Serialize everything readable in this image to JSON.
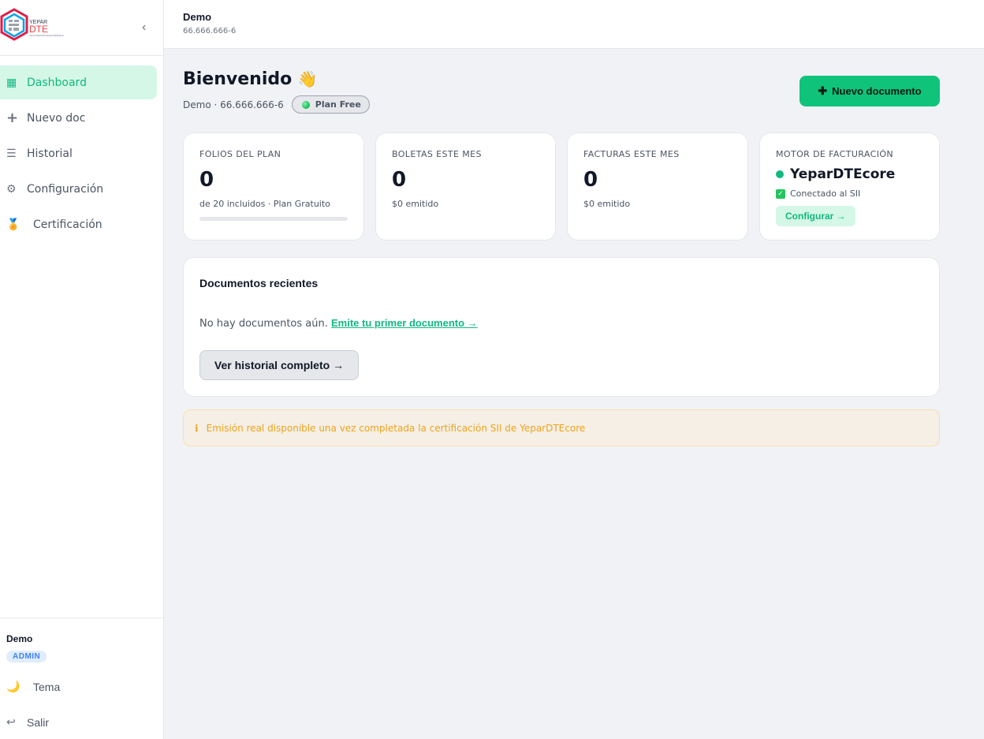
{
  "brand": {
    "logo_top": "YEPAR",
    "logo_main": "DTE",
    "logo_tagline": "FACTURACIÓN ELECTRÓNICA",
    "collapse": "‹"
  },
  "sidebar": {
    "items": [
      {
        "label": "Dashboard",
        "icon": "grid-icon",
        "glyph": "▦",
        "active": true
      },
      {
        "label": "Nuevo doc",
        "icon": "plus-icon",
        "glyph": "+"
      },
      {
        "label": "Historial",
        "icon": "list-icon",
        "glyph": "☰"
      },
      {
        "label": "Configuración",
        "icon": "gear-icon",
        "glyph": "⚙"
      },
      {
        "label": "Certificación",
        "icon": "medal-icon",
        "glyph": "🏅"
      }
    ],
    "footer": {
      "user": "Demo",
      "role": "ADMIN",
      "theme_label": "Tema",
      "theme_glyph": "🌙",
      "logout_label": "Salir",
      "logout_glyph": "↩"
    }
  },
  "topbar": {
    "title": "Demo",
    "subtitle": "66.666.666-6"
  },
  "header": {
    "welcome": "Bienvenido",
    "wave": "👋",
    "company_line": "Demo · 66.666.666-6",
    "plan": "Plan Free",
    "new_button": "Nuevo documento",
    "new_button_glyph": "✚"
  },
  "cards": {
    "folios": {
      "label": "FOLIOS DEL PLAN",
      "value": "0",
      "sub": "de 20 incluidos · Plan Gratuito",
      "progress": 0
    },
    "boletas": {
      "label": "BOLETAS ESTE MES",
      "value": "0",
      "sub": "$0 emitido"
    },
    "facturas": {
      "label": "FACTURAS ESTE MES",
      "value": "0",
      "sub": "$0 emitido"
    },
    "motor": {
      "label": "MOTOR DE FACTURACIÓN",
      "name": "YeparDTEcore",
      "status": "Conectado al SII",
      "button": "Configurar →"
    }
  },
  "recent": {
    "title": "Documentos recientes",
    "empty_text": "No hay documentos aún.",
    "empty_link": "Emite tu primer documento →",
    "history_button": "Ver historial completo →"
  },
  "notice": {
    "icon": "ℹ",
    "text": "Emisión real disponible una vez completada la certificación SII de YeparDTEcore"
  },
  "colors": {
    "accent": "#10b981",
    "button": "#0fc37a",
    "warning": "#f0a41a"
  }
}
